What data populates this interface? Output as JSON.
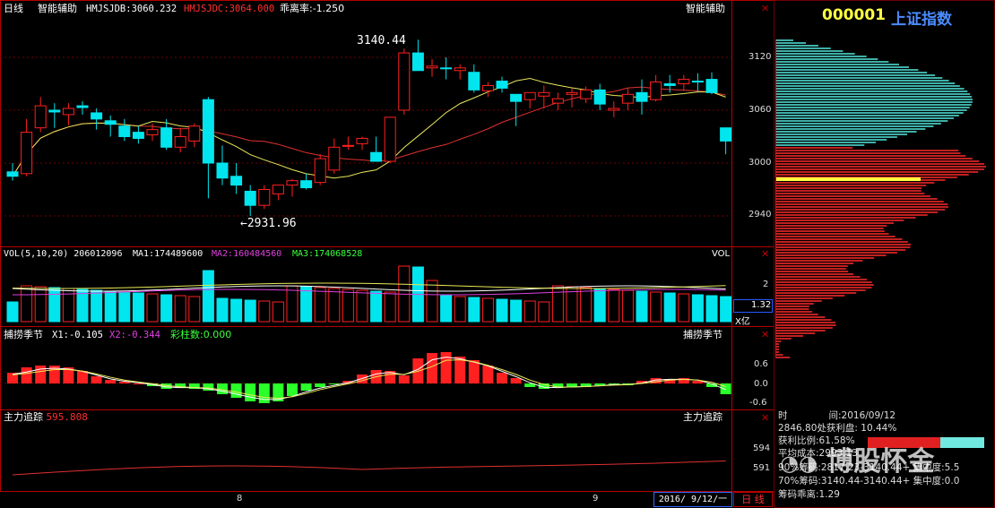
{
  "colors": {
    "up": "#ff2020",
    "down": "#00e5ee",
    "ma_yellow": "#e8e85a",
    "ma_red": "#e03030",
    "vol_ma_white": "#ffffff",
    "vol_ma_yellow": "#e8e85a",
    "vol_ma_magenta": "#e040e0",
    "grid": "#700000",
    "axis": "#c00000",
    "green_bar": "#2aff2a",
    "highlight": "#ffff40"
  },
  "main": {
    "period_label": "日线",
    "indicator_name": "智能辅助",
    "hmjsjdb": "HMJSJDB:3060.232",
    "hmjsjdc": "HMJSJDC:3064.000",
    "deviation": "乖离率:-1.250",
    "right_title": "智能辅助",
    "high_label": "3140.44",
    "low_label": "2931.96",
    "y_ticks": [
      "3120",
      "3060",
      "3000",
      "2940"
    ]
  },
  "vol": {
    "title": "VOL(5,10,20)",
    "value": "206012096",
    "ma1": "MA1:174489600",
    "ma2": "MA2:160484560",
    "ma3": "MA3:174068528",
    "right_title": "VOL",
    "y_tick": "2",
    "current": "1.32",
    "unit": "X亿"
  },
  "season": {
    "title": "捕捞季节",
    "x1": "X1:-0.105",
    "x2": "X2:-0.344",
    "bars": "彩柱数:0.000",
    "right_title": "捕捞季节",
    "y_ticks": [
      "0.6",
      "0.0",
      "-0.6"
    ]
  },
  "tracking": {
    "title": "主力追踪",
    "value": "595.808",
    "right_title": "主力追踪",
    "y_ticks": [
      "594",
      "591"
    ]
  },
  "xaxis": {
    "labels": [
      "8",
      "9"
    ],
    "date_box": "2016/ 9/12/一",
    "period_box": "日 线"
  },
  "sidebar": {
    "code": "000001",
    "name": "上证指数",
    "y_ticks": [
      "3120",
      "3060",
      "3000",
      "2940"
    ],
    "info": [
      {
        "label": "时",
        "value": "间:2016/09/12"
      },
      {
        "label": "",
        "value": "2846.80处获利盘: 10.44%"
      },
      {
        "label": "",
        "value": "获利比例:61.58%"
      },
      {
        "label": "",
        "value": "平均成本:2993.13"
      },
      {
        "label": "",
        "value": "90%筹码:2817.23-3140.44+ 集中度:5.5"
      },
      {
        "label": "",
        "value": "70%筹码:3140.44-3140.44+ 集中度:0.0"
      },
      {
        "label": "",
        "value": "筹码乖离:1.29"
      }
    ],
    "watermark": "博股怀金"
  },
  "chart_data": {
    "type": "candlestick",
    "y_range": [
      2900,
      3150
    ],
    "candles": [
      [
        2990,
        3000,
        2980,
        2985
      ],
      [
        2988,
        3050,
        2985,
        3035
      ],
      [
        3040,
        3075,
        3035,
        3065
      ],
      [
        3060,
        3068,
        3040,
        3058
      ],
      [
        3055,
        3068,
        3043,
        3062
      ],
      [
        3065,
        3070,
        3055,
        3063
      ],
      [
        3057,
        3062,
        3038,
        3050
      ],
      [
        3048,
        3054,
        3030,
        3044
      ],
      [
        3042,
        3050,
        3025,
        3030
      ],
      [
        3035,
        3042,
        3022,
        3028
      ],
      [
        3032,
        3045,
        3025,
        3038
      ],
      [
        3040,
        3050,
        3015,
        3018
      ],
      [
        3018,
        3040,
        3012,
        3030
      ],
      [
        3025,
        3045,
        3018,
        3042
      ],
      [
        3072,
        3075,
        2960,
        3000
      ],
      [
        3000,
        3020,
        2975,
        2983
      ],
      [
        2985,
        3000,
        2965,
        2975
      ],
      [
        2968,
        2975,
        2940,
        2952
      ],
      [
        2952,
        2975,
        2948,
        2970
      ],
      [
        2965,
        2975,
        2958,
        2975
      ],
      [
        2975,
        2982,
        2962,
        2980
      ],
      [
        2980,
        2988,
        2970,
        2972
      ],
      [
        2978,
        3010,
        2975,
        3005
      ],
      [
        2992,
        3028,
        2988,
        3018
      ],
      [
        3020,
        3030,
        3015,
        3020
      ],
      [
        3022,
        3030,
        3015,
        3028
      ],
      [
        3012,
        3030,
        3005,
        3002
      ],
      [
        3002,
        3052,
        3000,
        3052
      ],
      [
        3060,
        3130,
        3055,
        3125
      ],
      [
        3125,
        3140,
        3105,
        3105
      ],
      [
        3108,
        3118,
        3098,
        3110
      ],
      [
        3108,
        3120,
        3095,
        3107
      ],
      [
        3105,
        3112,
        3095,
        3108
      ],
      [
        3103,
        3112,
        3080,
        3083
      ],
      [
        3082,
        3092,
        3075,
        3088
      ],
      [
        3093,
        3098,
        3080,
        3085
      ],
      [
        3078,
        3078,
        3042,
        3070
      ],
      [
        3072,
        3080,
        3062,
        3080
      ],
      [
        3076,
        3088,
        3062,
        3080
      ],
      [
        3068,
        3080,
        3060,
        3073
      ],
      [
        3078,
        3085,
        3063,
        3080
      ],
      [
        3073,
        3087,
        3068,
        3083
      ],
      [
        3083,
        3090,
        3060,
        3067
      ],
      [
        3060,
        3070,
        3052,
        3062
      ],
      [
        3068,
        3085,
        3060,
        3078
      ],
      [
        3080,
        3095,
        3055,
        3070
      ],
      [
        3072,
        3100,
        3070,
        3092
      ],
      [
        3090,
        3100,
        3080,
        3088
      ],
      [
        3090,
        3100,
        3082,
        3095
      ],
      [
        3093,
        3102,
        3080,
        3092
      ],
      [
        3095,
        3103,
        3078,
        3080
      ],
      [
        3040,
        3040,
        3010,
        3025
      ]
    ]
  }
}
